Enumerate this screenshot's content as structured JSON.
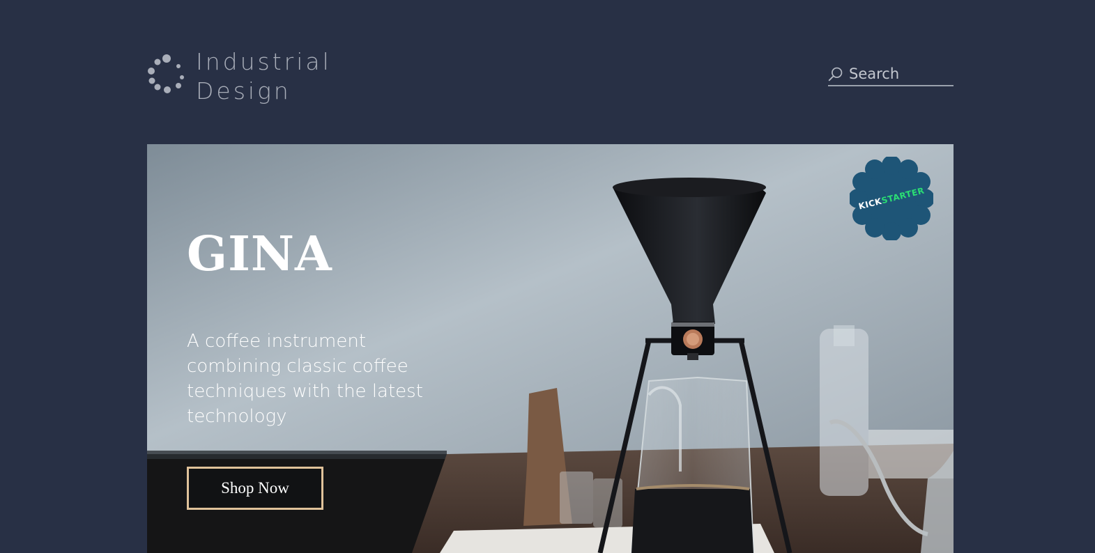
{
  "brand": {
    "line1": "Industrial",
    "line2": "Design"
  },
  "search": {
    "placeholder": "Search",
    "icon": "search-icon"
  },
  "hero": {
    "title": "GINA",
    "description": "A coffee instrument combining classic coffee techniques with the latest technology",
    "cta_label": "Shop Now"
  },
  "badge": {
    "part1": "KICK",
    "part2": "STARTER",
    "color": "#1e5577",
    "text_color": "#2bde73"
  },
  "colors": {
    "background": "#283045",
    "cta_border": "#e0c29a"
  }
}
